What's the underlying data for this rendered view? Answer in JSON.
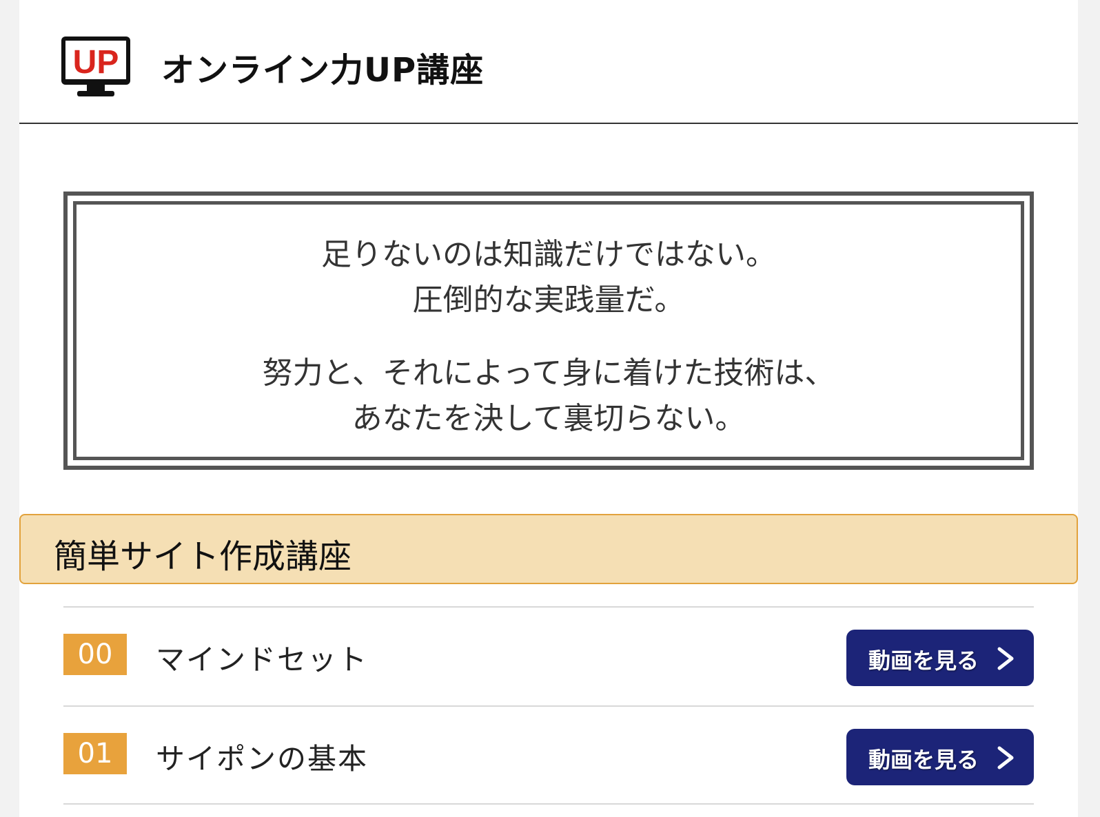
{
  "header": {
    "logo_text": "UP",
    "title": "オンライン力UP講座"
  },
  "quote": {
    "lines_1": [
      "足りないのは知識だけではない。",
      "圧倒的な実践量だ。"
    ],
    "lines_2": [
      "努力と、それによって身に着けた技術は、",
      "あなたを決して裏切らない。"
    ]
  },
  "section": {
    "title": "簡単サイト作成講座"
  },
  "lessons": [
    {
      "number": "00",
      "title": "マインドセット",
      "button_label": "動画を見る"
    },
    {
      "number": "01",
      "title": "サイポンの基本",
      "button_label": "動画を見る"
    }
  ],
  "colors": {
    "accent_orange": "#e8a23c",
    "section_bg": "#f5dfb4",
    "button_navy": "#1c2478",
    "logo_red": "#d9251d"
  }
}
